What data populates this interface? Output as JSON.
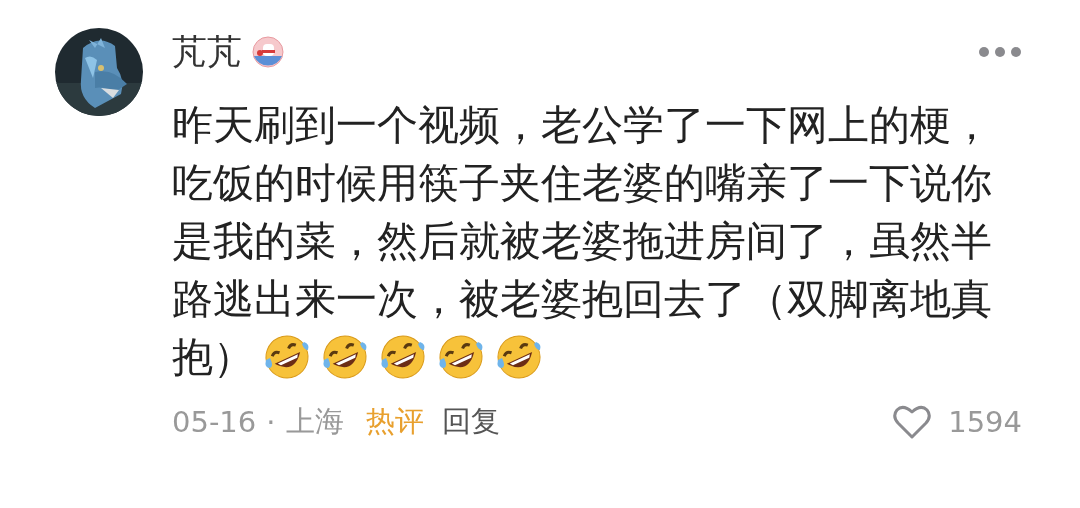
{
  "comment": {
    "author": "芃芃",
    "text_lines": [
      "昨天刷到一个视频，老公学了一下网上的梗，",
      "吃饭的时候用筷子夹住老婆的嘴亲了一下说你",
      "是我的菜，然后就被老婆拖进房间了，虽然半",
      "路逃出来一次，被老婆抱回去了（双脚离地真",
      "抱）"
    ],
    "emojis": [
      {
        "kind": "rofl"
      },
      {
        "kind": "rofl"
      },
      {
        "kind": "rofl"
      },
      {
        "kind": "rofl"
      },
      {
        "kind": "rofl"
      }
    ],
    "date": "05-16",
    "separator": "·",
    "location": "上海",
    "hot_tag": "热评",
    "reply": "回复",
    "likes": "1594",
    "liked": false
  }
}
